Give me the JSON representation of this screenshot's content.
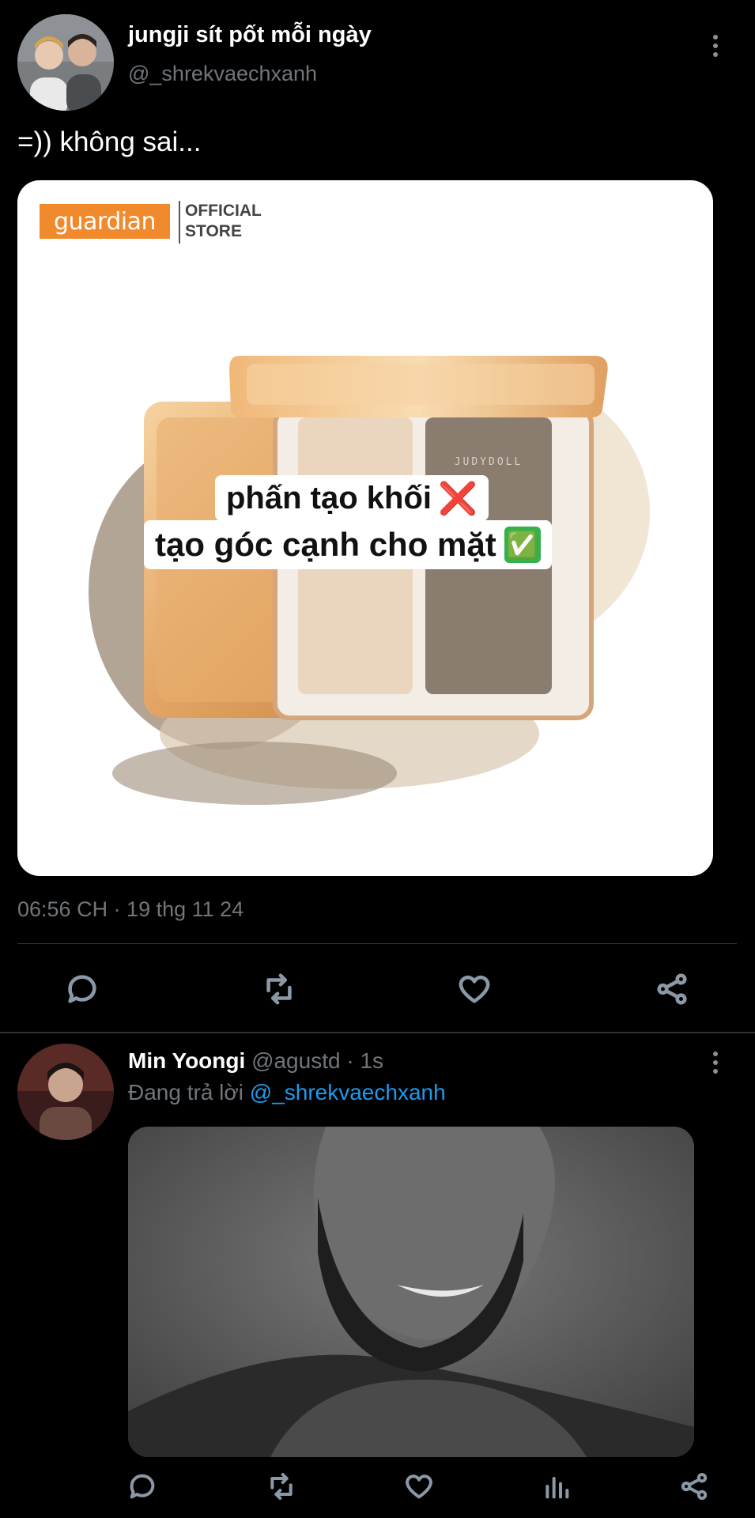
{
  "tweet": {
    "display_name": "jungji sít pốt mỗi ngày",
    "handle": "@_shrekvaechxanh",
    "text": "=)) không sai...",
    "image": {
      "brand": "guardian",
      "store_line1": "OFFICIAL",
      "store_line2": "STORE",
      "product_name": "JUDYDOLL",
      "caption_line1": "phấn tạo khối",
      "caption_line1_emoji": "❌",
      "caption_line2": "tạo góc cạnh cho mặt",
      "caption_line2_emoji": "✅"
    },
    "timestamp": "06:56 CH · 19 thg 11 24",
    "actions": [
      "reply-icon",
      "retweet-icon",
      "like-icon",
      "share-icon"
    ]
  },
  "reply": {
    "display_name": "Min Yoongi",
    "handle_time": "@agustd · 1s",
    "replying_prefix": "Đang trả lời",
    "replying_to": "@_shrekvaechxanh",
    "actions": [
      "reply-icon",
      "retweet-icon",
      "like-icon",
      "views-icon",
      "share-icon"
    ]
  },
  "colors": {
    "background": "#000000",
    "link": "#1d9bf0",
    "muted": "#71767b",
    "guardian_orange": "#f18a2c"
  }
}
